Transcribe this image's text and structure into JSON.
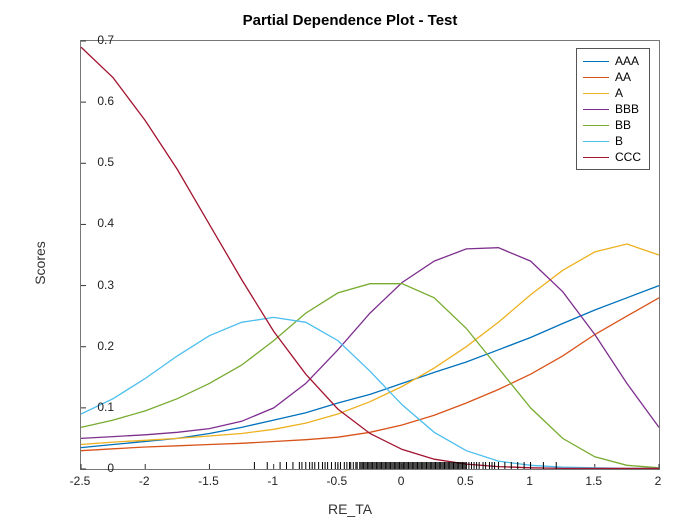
{
  "chart_data": {
    "type": "line",
    "title": "Partial Dependence Plot - Test",
    "xlabel": "RE_TA",
    "ylabel": "Scores",
    "xlim": [
      -2.5,
      2.0
    ],
    "ylim": [
      0,
      0.7
    ],
    "xticks": [
      -2.5,
      -2,
      -1.5,
      -1,
      -0.5,
      0,
      0.5,
      1,
      1.5,
      2
    ],
    "yticks": [
      0,
      0.1,
      0.2,
      0.3,
      0.4,
      0.5,
      0.6,
      0.7
    ],
    "legend_position": "upper-right",
    "x": [
      -2.5,
      -2.25,
      -2.0,
      -1.75,
      -1.5,
      -1.25,
      -1.0,
      -0.75,
      -0.5,
      -0.25,
      0.0,
      0.25,
      0.5,
      0.75,
      1.0,
      1.25,
      1.5,
      1.75,
      2.0
    ],
    "series": [
      {
        "name": "AAA",
        "color": "#0072BD",
        "values": [
          0.035,
          0.04,
          0.045,
          0.05,
          0.058,
          0.068,
          0.08,
          0.092,
          0.108,
          0.122,
          0.14,
          0.158,
          0.175,
          0.195,
          0.215,
          0.238,
          0.26,
          0.28,
          0.3
        ]
      },
      {
        "name": "AA",
        "color": "#D95319",
        "values": [
          0.03,
          0.033,
          0.036,
          0.038,
          0.04,
          0.042,
          0.045,
          0.048,
          0.052,
          0.06,
          0.072,
          0.088,
          0.108,
          0.13,
          0.155,
          0.185,
          0.22,
          0.25,
          0.28
        ]
      },
      {
        "name": "A",
        "color": "#EDB120",
        "values": [
          0.04,
          0.044,
          0.047,
          0.05,
          0.054,
          0.058,
          0.065,
          0.075,
          0.09,
          0.11,
          0.135,
          0.165,
          0.2,
          0.24,
          0.285,
          0.325,
          0.355,
          0.368,
          0.35
        ]
      },
      {
        "name": "BBB",
        "color": "#7E2F8E",
        "values": [
          0.05,
          0.053,
          0.056,
          0.06,
          0.066,
          0.078,
          0.1,
          0.14,
          0.195,
          0.255,
          0.305,
          0.34,
          0.36,
          0.362,
          0.34,
          0.29,
          0.22,
          0.14,
          0.068
        ]
      },
      {
        "name": "BB",
        "color": "#77AC30",
        "values": [
          0.068,
          0.08,
          0.095,
          0.115,
          0.14,
          0.17,
          0.21,
          0.255,
          0.288,
          0.303,
          0.303,
          0.28,
          0.23,
          0.165,
          0.1,
          0.05,
          0.02,
          0.006,
          0.002
        ]
      },
      {
        "name": "B",
        "color": "#4DBEEE",
        "values": [
          0.09,
          0.115,
          0.148,
          0.185,
          0.218,
          0.24,
          0.248,
          0.24,
          0.21,
          0.16,
          0.105,
          0.06,
          0.03,
          0.013,
          0.006,
          0.003,
          0.002,
          0.001,
          0.001
        ]
      },
      {
        "name": "CCC",
        "color": "#A2142F",
        "values": [
          0.69,
          0.64,
          0.57,
          0.49,
          0.4,
          0.31,
          0.225,
          0.155,
          0.098,
          0.058,
          0.032,
          0.016,
          0.008,
          0.004,
          0.002,
          0.001,
          0.001,
          0.001,
          0.001
        ]
      }
    ],
    "rug": [
      -1.15,
      -1.05,
      -0.95,
      -0.9,
      -0.85,
      -0.8,
      -0.78,
      -0.75,
      -0.72,
      -0.7,
      -0.68,
      -0.65,
      -0.62,
      -0.6,
      -0.58,
      -0.55,
      -0.52,
      -0.5,
      -0.48,
      -0.45,
      -0.43,
      -0.41,
      -0.4,
      -0.38,
      -0.36,
      -0.35,
      -0.33,
      -0.32,
      -0.31,
      -0.3,
      -0.29,
      -0.28,
      -0.27,
      -0.26,
      -0.25,
      -0.24,
      -0.23,
      -0.22,
      -0.21,
      -0.2,
      -0.19,
      -0.18,
      -0.17,
      -0.16,
      -0.15,
      -0.14,
      -0.13,
      -0.12,
      -0.11,
      -0.1,
      -0.09,
      -0.08,
      -0.07,
      -0.06,
      -0.05,
      -0.04,
      -0.03,
      -0.02,
      -0.01,
      0.0,
      0.01,
      0.02,
      0.03,
      0.04,
      0.05,
      0.06,
      0.07,
      0.08,
      0.09,
      0.1,
      0.11,
      0.12,
      0.13,
      0.14,
      0.15,
      0.16,
      0.17,
      0.18,
      0.19,
      0.2,
      0.21,
      0.22,
      0.23,
      0.24,
      0.25,
      0.26,
      0.27,
      0.28,
      0.29,
      0.3,
      0.31,
      0.32,
      0.33,
      0.34,
      0.35,
      0.36,
      0.37,
      0.38,
      0.39,
      0.4,
      0.41,
      0.42,
      0.43,
      0.44,
      0.45,
      0.46,
      0.47,
      0.48,
      0.49,
      0.5,
      0.52,
      0.54,
      0.56,
      0.58,
      0.6,
      0.63,
      0.65,
      0.68,
      0.7,
      0.72,
      0.75,
      0.8,
      0.85,
      0.9,
      0.95,
      1.0,
      1.1,
      1.2
    ]
  }
}
